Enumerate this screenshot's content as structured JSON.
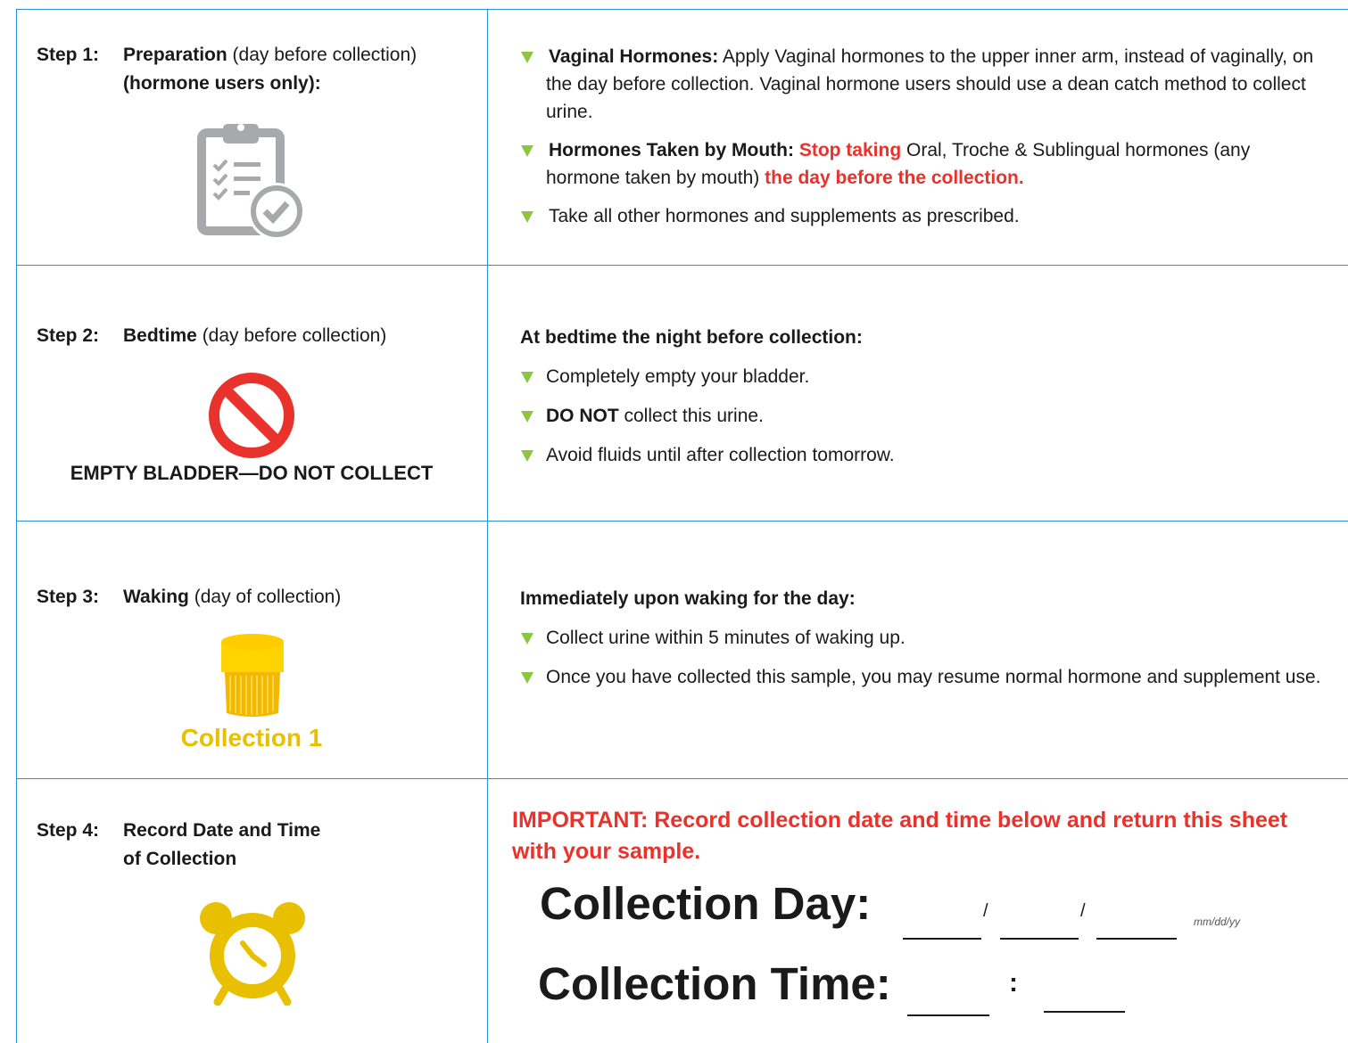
{
  "step1": {
    "num": "Step 1:",
    "title_bold": "Preparation",
    "title_rest": " (day before collection)",
    "line2": "(hormone users only):",
    "b1_bold": "Vaginal Hormones:",
    "b1_text": " Apply Vaginal hormones to the upper inner arm, instead of vaginally, on the day before collection. Vaginal hormone users should use a dean catch method to collect urine.",
    "b2_bold": "Hormones Taken by Mouth:",
    "b2_red": "Stop taking",
    "b2_text": " Oral, Troche & Sublingual hormones (any hormone taken by mouth) ",
    "b2_red2": "the day before the collection.",
    "b3": "Take all other hormones and supplements as prescribed."
  },
  "step2": {
    "num": "Step 2:",
    "title_bold": "Bedtime",
    "title_rest": " (day before collection)",
    "caption": "EMPTY BLADDER—DO NOT COLLECT",
    "header": "At bedtime the night before collection:",
    "b1": "Completely empty your bladder.",
    "b2_bold": "DO NOT",
    "b2_text": " collect this urine.",
    "b3": "Avoid fluids until after collection tomorrow."
  },
  "step3": {
    "num": "Step 3:",
    "title_bold": "Waking",
    "title_rest": " (day of collection)",
    "caption": "Collection 1",
    "header": "Immediately upon waking for the day:",
    "b1": "Collect urine within 5 minutes of waking up.",
    "b2": "Once you have collected this sample, you may resume normal hormone and supplement use."
  },
  "step4": {
    "num": "Step 4:",
    "title_line1": "Record Date and Time",
    "title_line2": "of Collection",
    "important": "IMPORTANT: Record collection date and time below and return this sheet with your sample.",
    "day_label": "Collection Day:",
    "time_label": "Collection Time:",
    "slash": "/",
    "colon": ":",
    "date_format": "mm/dd/yy"
  },
  "colors": {
    "border": "#2f8fd0",
    "bullet": "#8cc63f",
    "red": "#e8322b",
    "gold": "#e8c000"
  },
  "icons": [
    "clipboard-checklist-icon",
    "prohibited-icon",
    "urine-cup-icon",
    "alarm-clock-icon"
  ]
}
